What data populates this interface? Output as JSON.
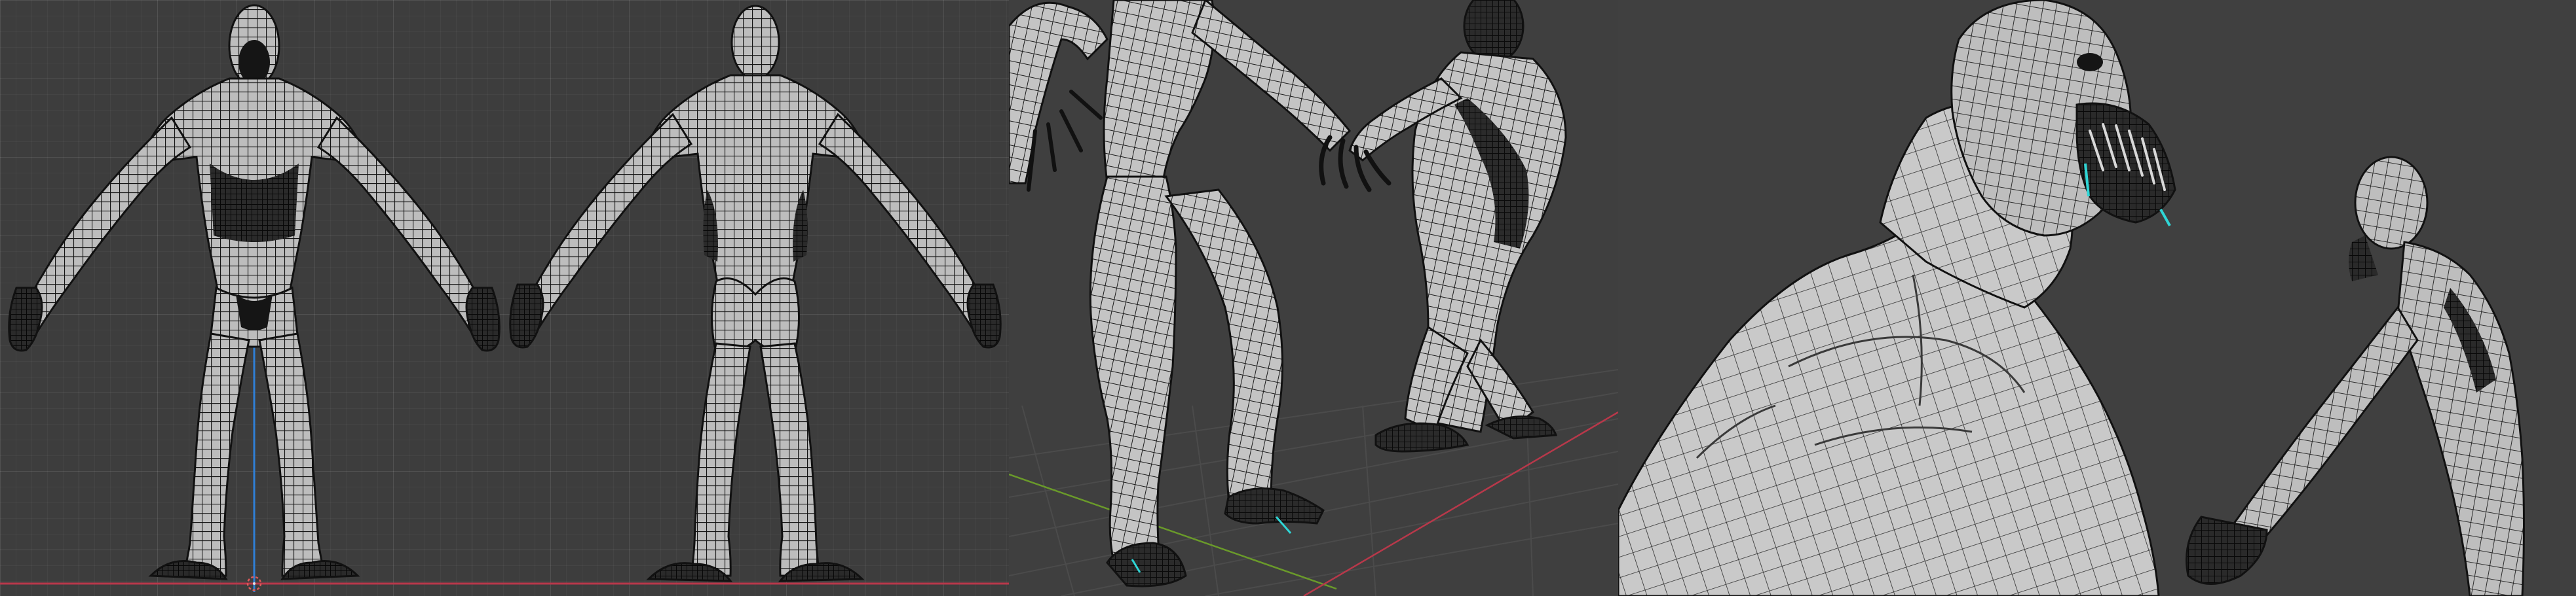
{
  "app": {
    "kind": "3d-viewport-collage"
  },
  "viewports": [
    {
      "id": "orthographic-front-back",
      "view": "orthographic",
      "figures": [
        "front-view",
        "back-view"
      ],
      "grid": true,
      "axis_lines": [
        "z-axis-blue",
        "x-axis-red"
      ]
    },
    {
      "id": "perspective-full-body",
      "view": "perspective",
      "figures": [
        "creature-near",
        "creature-far"
      ],
      "grid": true,
      "axis_lines": [
        "x-axis-red",
        "y-axis-green"
      ]
    },
    {
      "id": "perspective-close-up",
      "view": "perspective",
      "figures": [
        "creature-head-torso",
        "creature-background"
      ],
      "grid": false
    }
  ],
  "colors": {
    "viewport_bg": "#3d3d3d",
    "grid_line": "#4a4a4a",
    "mesh_surface": "#c8c8c8",
    "wire": "#111111",
    "axis_x": "#b8384a",
    "axis_y": "#6a9a2a",
    "axis_z": "#2f7fd6",
    "selection_cyan": "#2fd6d6"
  },
  "icons": [
    "3d-cursor-icon"
  ]
}
